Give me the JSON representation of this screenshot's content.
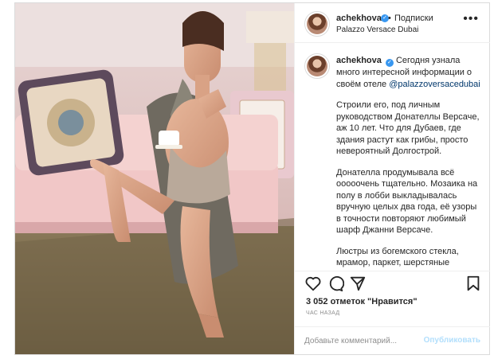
{
  "header": {
    "username": "achekhova",
    "separator": "•",
    "follow_label": "Подписки",
    "location": "Palazzo Versace Dubai",
    "more_icon": "more-horizontal-icon"
  },
  "caption": {
    "username": "achekhova",
    "intro": "Сегодня узнала много интересной информации о своём отеле",
    "mention": "@palazzoversacedubai",
    "paragraphs": [
      "Строили его, под личным руководством Донателлы Версаче, аж 10 лет. Что для Дубаев, где здания растут как грибы, просто невероятный Долгострой.",
      "Донателла продумывала всё ооооочень тщательно. Мозаика на полу в лобби выкладывалась вручную целых два года, её узоры в точности повторяют любимый шарф Джанни Версаче.",
      "Люстры из богемского стекла, мрамор, паркет, шерстяные"
    ]
  },
  "actions": {
    "icons": [
      "heart-icon",
      "comment-icon",
      "share-icon",
      "bookmark-icon"
    ],
    "likes_text": "3 052 отметок \"Нравится\"",
    "time_text": "ЧАС НАЗАД"
  },
  "comment": {
    "placeholder": "Добавьте комментарий...",
    "publish_label": "Опубликовать"
  },
  "colors": {
    "accent": "#3897f0",
    "publish_disabled": "#b2dffc",
    "border": "#dbdbdb",
    "muted": "#8e8e8e"
  }
}
